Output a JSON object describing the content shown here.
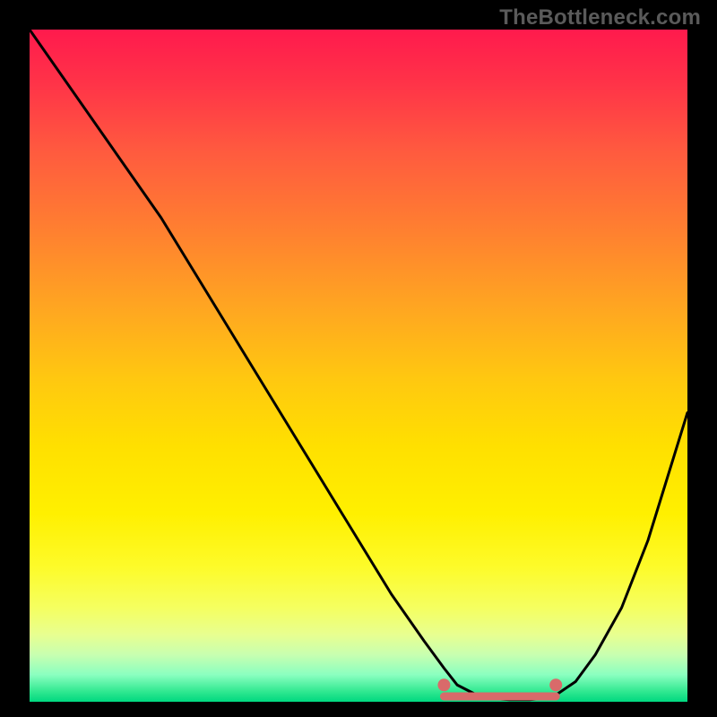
{
  "watermark": "TheBottleneck.com",
  "chart_data": {
    "type": "line",
    "title": "",
    "xlabel": "",
    "ylabel": "",
    "xlim": [
      0,
      100
    ],
    "ylim": [
      0,
      100
    ],
    "grid": false,
    "series": [
      {
        "name": "curve",
        "color": "#000000",
        "x": [
          0,
          5,
          10,
          15,
          20,
          25,
          30,
          35,
          40,
          45,
          50,
          55,
          60,
          63,
          65,
          68,
          70,
          73,
          76,
          78,
          80,
          83,
          86,
          90,
          94,
          100
        ],
        "values": [
          100,
          93,
          86,
          79,
          72,
          64,
          56,
          48,
          40,
          32,
          24,
          16,
          9,
          5,
          2.5,
          1,
          0.5,
          0.3,
          0.3,
          0.5,
          1,
          3,
          7,
          14,
          24,
          43
        ]
      }
    ],
    "markers": [
      {
        "name": "flat-start",
        "color": "#d96a6a",
        "x": 63,
        "y": 2.5
      },
      {
        "name": "flat-end",
        "color": "#d96a6a",
        "x": 80,
        "y": 2.5
      }
    ],
    "flat_segment": {
      "color": "#d96a6a",
      "x_start": 63,
      "x_end": 80,
      "y": 0.8
    }
  }
}
